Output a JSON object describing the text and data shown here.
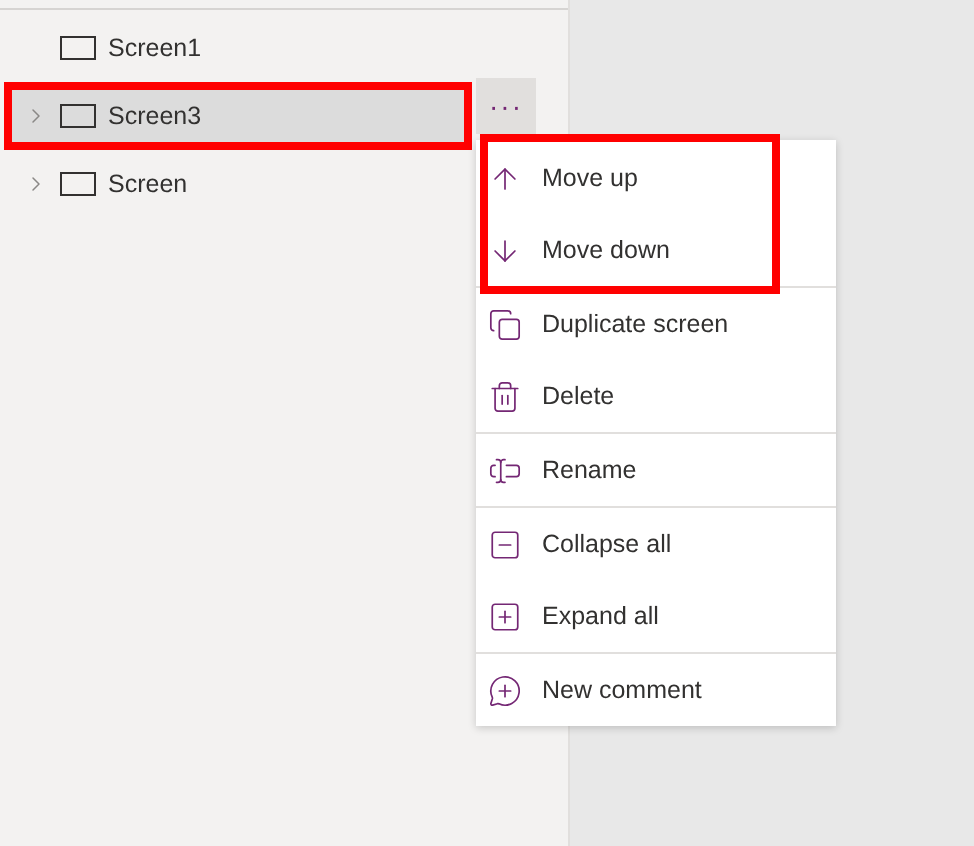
{
  "tree": [
    {
      "label": "Screen1",
      "expandable": false,
      "selected": false,
      "highlighted": false
    },
    {
      "label": "Screen3",
      "expandable": true,
      "selected": true,
      "highlighted": true
    },
    {
      "label": "Screen",
      "expandable": true,
      "selected": false,
      "highlighted": false
    }
  ],
  "more_button": {
    "label": "···"
  },
  "context_menu": {
    "groups": [
      {
        "highlighted": true,
        "items": [
          {
            "kind": "up",
            "label": "Move up"
          },
          {
            "kind": "down",
            "label": "Move down"
          }
        ]
      },
      {
        "highlighted": false,
        "items": [
          {
            "kind": "duplicate",
            "label": "Duplicate screen"
          },
          {
            "kind": "delete",
            "label": "Delete"
          }
        ]
      },
      {
        "highlighted": false,
        "items": [
          {
            "kind": "rename",
            "label": "Rename"
          }
        ]
      },
      {
        "highlighted": false,
        "items": [
          {
            "kind": "collapse",
            "label": "Collapse all"
          },
          {
            "kind": "expand",
            "label": "Expand all"
          }
        ]
      },
      {
        "highlighted": false,
        "items": [
          {
            "kind": "comment",
            "label": "New comment"
          }
        ]
      }
    ]
  }
}
